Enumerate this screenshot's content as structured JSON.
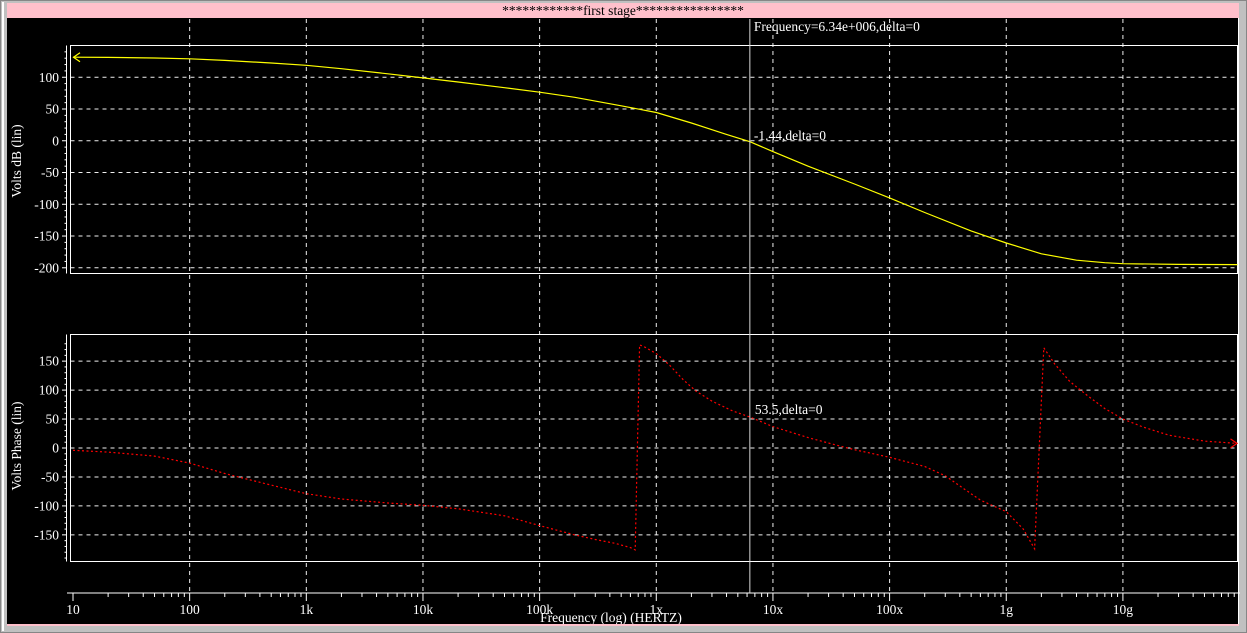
{
  "window": {
    "title": "************first stage****************",
    "titlebar_color": "#ffc0cb"
  },
  "cursor": {
    "frequency_hz": 6340000,
    "frequency_label": "Frequency=6.34e+006,delta=0",
    "gain_value_label": "-1.44,delta=0",
    "phase_value_label": "53.5,delta=0",
    "gain_value_db": -1.44,
    "phase_value_deg": 53.5
  },
  "x_axis": {
    "title": "Frequency (log) (HERTZ)",
    "scale": "log",
    "xlim": [
      10,
      96000000000
    ],
    "tick_labels": [
      "10",
      "100",
      "1k",
      "10k",
      "100k",
      "1x",
      "10x",
      "100x",
      "1g",
      "10g"
    ],
    "tick_values": [
      10,
      100,
      1000,
      10000,
      100000,
      1000000,
      10000000,
      100000000,
      1000000000,
      10000000000
    ]
  },
  "colors": {
    "background": "#000000",
    "grid": "#ffffff",
    "gain_curve": "#ffff00",
    "phase_curve": "#ff0000",
    "cursor_line": "#d8d8d8",
    "text": "#ffffff",
    "window_chrome": "#c0c0c0",
    "bottom_accent": "#ffc0cb"
  },
  "chart_data": [
    {
      "type": "line",
      "name": "gain-plot",
      "title": "",
      "xlabel": "Frequency (log) (HERTZ)",
      "ylabel": "Volts dB (lin)",
      "x_scale": "log",
      "grid": true,
      "legend": "none",
      "ylim": [
        -209,
        150
      ],
      "y_ticks": [
        100,
        50,
        0,
        -50,
        -100,
        -150,
        -200
      ],
      "series": [
        {
          "name": "gain",
          "color": "#ffff00",
          "line_style": "solid",
          "start_arrow": true,
          "x": [
            10,
            20,
            50,
            100,
            200,
            500,
            1000,
            2000,
            5000,
            10000,
            20000,
            50000,
            100000,
            200000,
            500000,
            1000000,
            2000000,
            4000000,
            6340000,
            10000000,
            20000000,
            50000000,
            100000000,
            200000000,
            500000000,
            1000000000,
            2000000000,
            4000000000,
            7000000000,
            10000000000,
            30000000000,
            96000000000
          ],
          "y": [
            131.5,
            131.2,
            130.3,
            129,
            126.6,
            122.5,
            118.8,
            113.5,
            105.5,
            99,
            92.5,
            83.5,
            76.5,
            68.5,
            55,
            44.5,
            28,
            10,
            -1.44,
            -17,
            -40,
            -68,
            -90,
            -113,
            -142,
            -161,
            -178,
            -188,
            -192,
            -193.5,
            -194.6,
            -195
          ]
        }
      ]
    },
    {
      "type": "line",
      "name": "phase-plot",
      "title": "",
      "xlabel": "Frequency (log) (HERTZ)",
      "ylabel": "Volts Phase (lin)",
      "x_scale": "log",
      "grid": true,
      "legend": "none",
      "ylim": [
        -196,
        196
      ],
      "y_ticks": [
        150,
        100,
        50,
        0,
        -50,
        -100,
        -150
      ],
      "series": [
        {
          "name": "phase",
          "color": "#ff0000",
          "line_style": "dotted",
          "end_arrow": true,
          "x": [
            10,
            20,
            50,
            100,
            200,
            300,
            500,
            1000,
            2000,
            5000,
            10000,
            20000,
            50000,
            100000,
            200000,
            300000,
            450000,
            600000,
            660000,
            720000,
            800000,
            1000000,
            1300000,
            1700000,
            2200000,
            3000000,
            4500000,
            6340000,
            8000000,
            10000000,
            20000000,
            35000000,
            50000000,
            100000000,
            200000000,
            300000000,
            430000000,
            600000000,
            1000000000,
            1400000000,
            1750000000,
            2100000000,
            2600000000,
            3500000000,
            5000000000,
            7000000000,
            10000000000,
            15000000000,
            25000000000,
            50000000000,
            96000000000
          ],
          "y": [
            -4,
            -7,
            -14,
            -26,
            -44,
            -53,
            -64,
            -79,
            -88,
            -95,
            -99,
            -105,
            -117,
            -134,
            -150,
            -158,
            -165,
            -172,
            -176,
            178,
            174,
            163,
            143,
            118,
            98,
            81,
            64,
            53.5,
            45,
            37,
            18,
            5,
            -3,
            -16,
            -32,
            -48,
            -70,
            -90,
            -110,
            -140,
            -174,
            173,
            145,
            115,
            90,
            68,
            50,
            36,
            22,
            12,
            8
          ]
        }
      ]
    }
  ]
}
